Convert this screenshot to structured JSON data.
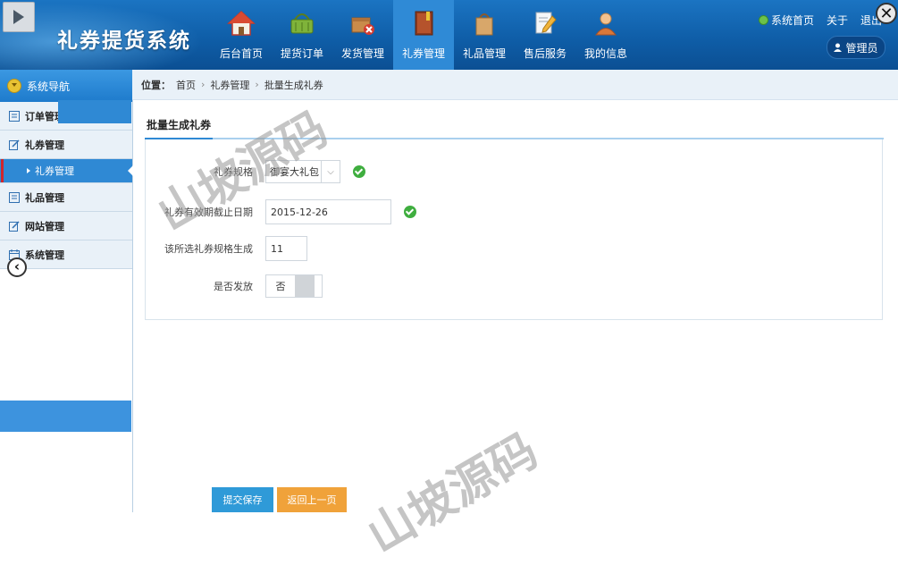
{
  "app": {
    "title": "礼券提货系统"
  },
  "nav": [
    {
      "label": "后台首页",
      "icon": "home-icon"
    },
    {
      "label": "提货订单",
      "icon": "basket-icon"
    },
    {
      "label": "发货管理",
      "icon": "package-icon"
    },
    {
      "label": "礼券管理",
      "icon": "book-icon",
      "active": true
    },
    {
      "label": "礼品管理",
      "icon": "gift-bag-icon"
    },
    {
      "label": "售后服务",
      "icon": "pencil-doc-icon"
    },
    {
      "label": "我的信息",
      "icon": "person-icon"
    }
  ],
  "topbar": {
    "home_link": "系统首页",
    "about_link": "关于",
    "logout_link": "退出",
    "user": "管理员"
  },
  "sidebar": {
    "header": "系统导航",
    "items": [
      {
        "label": "订单管理"
      },
      {
        "label": "礼券管理"
      },
      {
        "label": "礼券管理",
        "sub": true
      },
      {
        "label": "礼品管理"
      },
      {
        "label": "网站管理"
      },
      {
        "label": "系统管理"
      }
    ]
  },
  "breadcrumb": {
    "prefix": "位置：",
    "items": [
      "首页",
      "礼券管理",
      "批量生成礼券"
    ]
  },
  "form": {
    "title": "批量生成礼券",
    "spec_label": "礼券规格",
    "spec_value": "御宴大礼包",
    "expire_label": "礼券有效期截止日期",
    "expire_value": "2015-12-26",
    "count_label": "该所选礼券规格生成",
    "count_value": "11",
    "issue_label": "是否发放",
    "issue_value": "否"
  },
  "buttons": {
    "submit": "提交保存",
    "back": "返回上一页"
  },
  "watermark": "山坡源码",
  "colors": {
    "header": "#0f5ea8",
    "accent": "#2f89d4",
    "submit": "#2f9ad8",
    "back": "#f0a23a",
    "ok": "#3fae3f"
  }
}
